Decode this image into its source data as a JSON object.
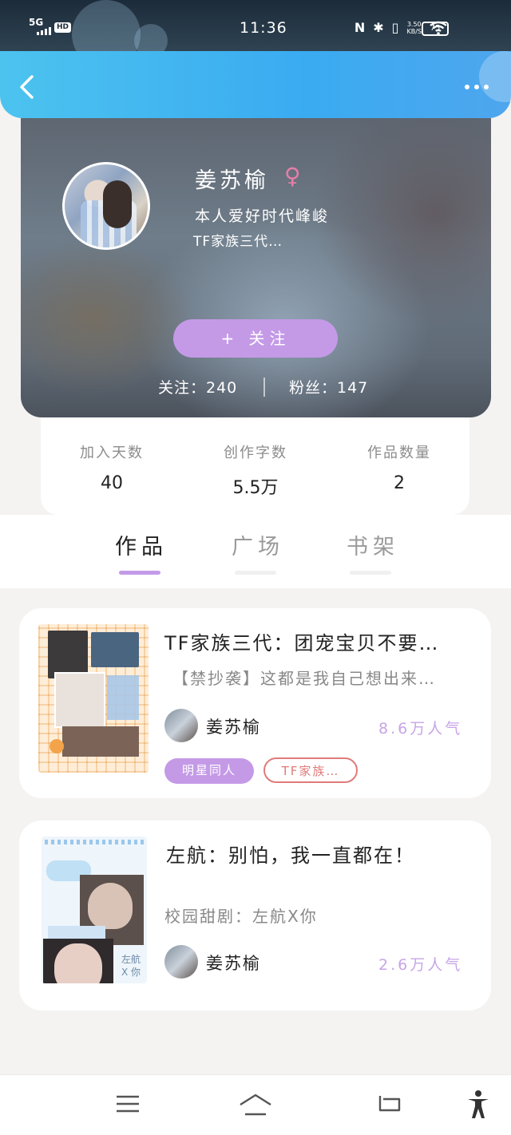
{
  "status_bar": {
    "network": "5G",
    "hd": "HD",
    "time": "11:36",
    "nfc": "N",
    "bluetooth": "✱",
    "vibrate": "▯",
    "speed_value": "3.50",
    "speed_unit": "KB/S",
    "battery": "75"
  },
  "profile": {
    "name": "姜苏榆",
    "gender_symbol": "♀",
    "bio_line1": "本人爱好时代峰峻",
    "bio_line2": "TF家族三代…",
    "follow_button": "+ 关注",
    "following_text": "关注：240",
    "fans_text": "粉丝：147"
  },
  "stats": [
    {
      "label": "加入天数",
      "value": "40"
    },
    {
      "label": "创作字数",
      "value": "5.5万"
    },
    {
      "label": "作品数量",
      "value": "2"
    }
  ],
  "tabs": [
    {
      "label": "作品",
      "active": true
    },
    {
      "label": "广场",
      "active": false
    },
    {
      "label": "书架",
      "active": false
    }
  ],
  "works": [
    {
      "title": "TF家族三代：团宠宝贝不要…",
      "description": "【禁抄袭】这都是我自己想出来…",
      "author": "姜苏榆",
      "popularity": "8.6万人气",
      "tags": [
        "明星同人",
        "TF家族…"
      ]
    },
    {
      "title": "左航：别怕，我一直都在！",
      "description": "校园甜剧：左航X你",
      "author": "姜苏榆",
      "popularity": "2.6万人气",
      "cover_text": "左航 X 你"
    }
  ],
  "colors": {
    "accent_purple": "#c49ae7",
    "header_blue": "#3aabf1",
    "tag_red": "#e07a7a"
  }
}
